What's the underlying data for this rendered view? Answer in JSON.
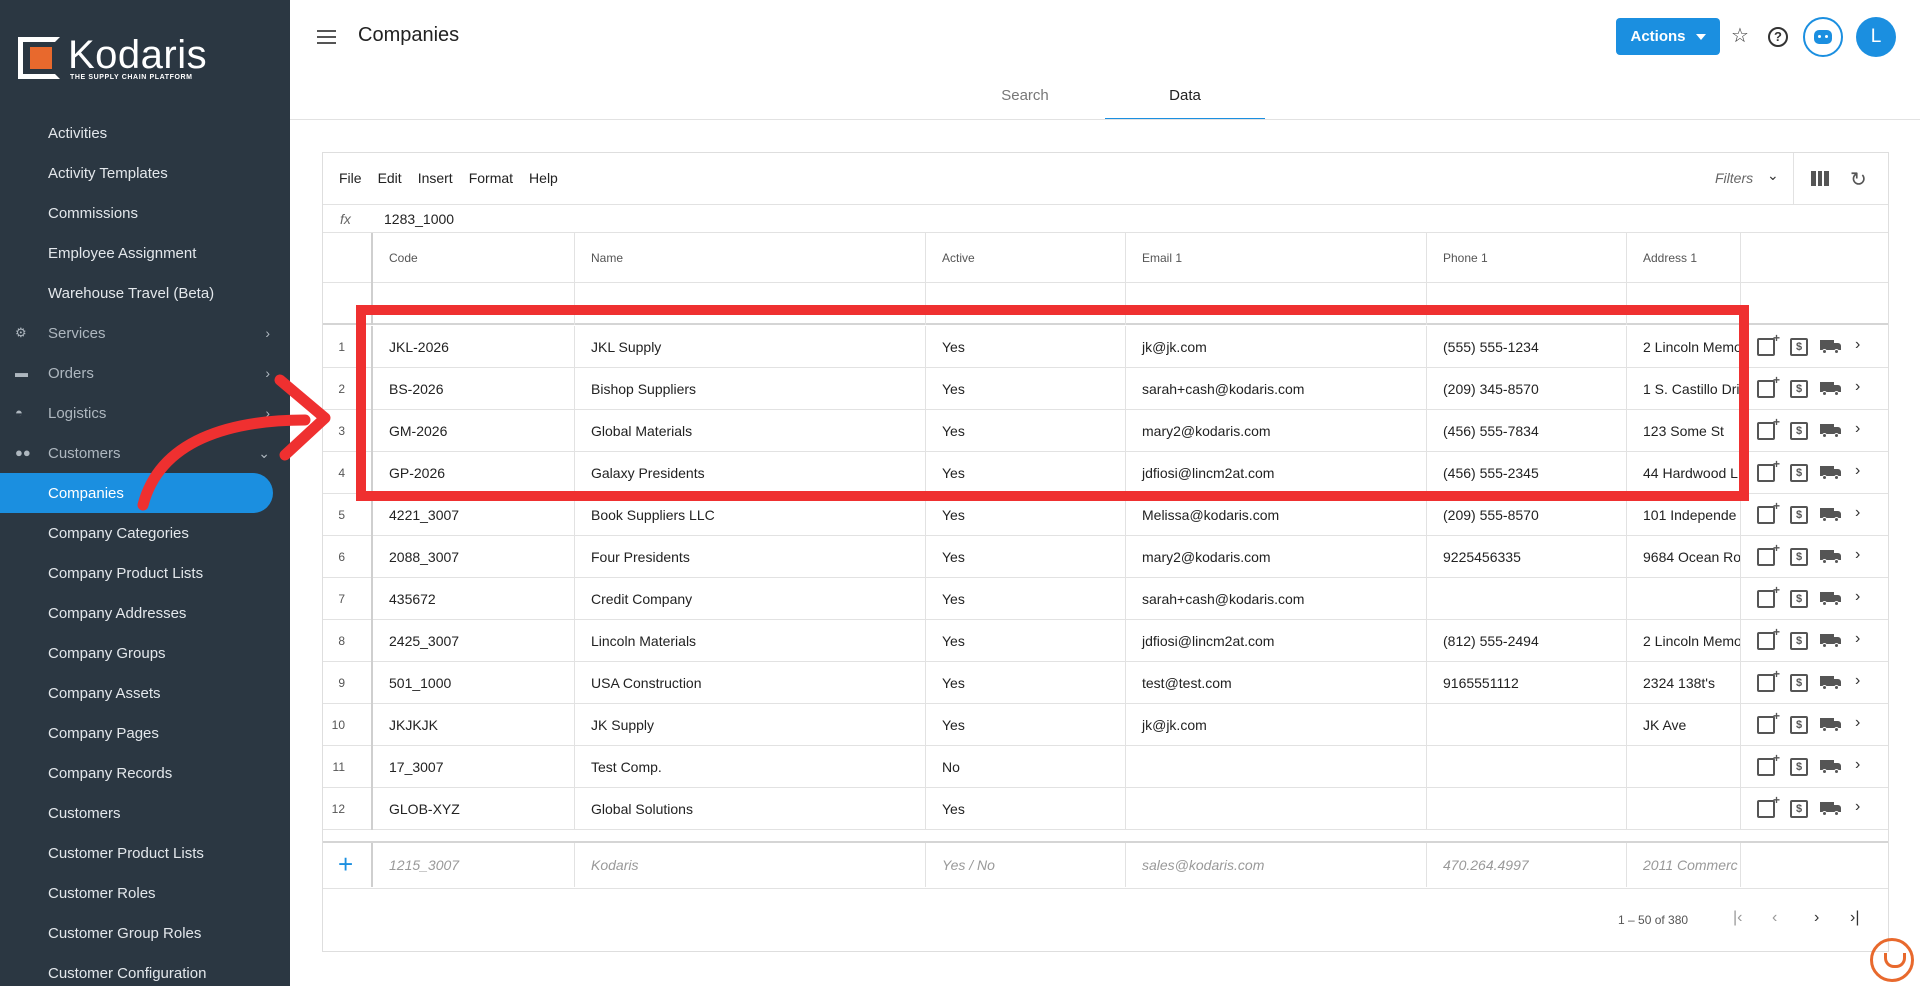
{
  "brand": {
    "name": "Kodaris",
    "tagline": "THE SUPPLY CHAIN PLATFORM"
  },
  "sidebar": {
    "items": [
      {
        "label": "Activities",
        "type": "sub"
      },
      {
        "label": "Activity Templates",
        "type": "sub"
      },
      {
        "label": "Commissions",
        "type": "sub"
      },
      {
        "label": "Employee Assignment",
        "type": "sub"
      },
      {
        "label": "Warehouse Travel (Beta)",
        "type": "sub"
      },
      {
        "label": "Services",
        "type": "group",
        "icon": "services-icon"
      },
      {
        "label": "Orders",
        "type": "group",
        "icon": "truck-icon"
      },
      {
        "label": "Logistics",
        "type": "group",
        "icon": "car-icon"
      },
      {
        "label": "Customers",
        "type": "group",
        "icon": "people-icon"
      },
      {
        "label": "Companies",
        "type": "active"
      },
      {
        "label": "Company Categories",
        "type": "sub"
      },
      {
        "label": "Company Product Lists",
        "type": "sub"
      },
      {
        "label": "Company Addresses",
        "type": "sub"
      },
      {
        "label": "Company Groups",
        "type": "sub"
      },
      {
        "label": "Company Assets",
        "type": "sub"
      },
      {
        "label": "Company Pages",
        "type": "sub"
      },
      {
        "label": "Company Records",
        "type": "sub"
      },
      {
        "label": "Customers",
        "type": "sub"
      },
      {
        "label": "Customer Product Lists",
        "type": "sub"
      },
      {
        "label": "Customer Roles",
        "type": "sub"
      },
      {
        "label": "Customer Group Roles",
        "type": "sub"
      },
      {
        "label": "Customer Configuration",
        "type": "sub"
      }
    ]
  },
  "header": {
    "title": "Companies",
    "actions_label": "Actions",
    "avatar_initial": "L"
  },
  "tabs": [
    {
      "label": "Search"
    },
    {
      "label": "Data"
    }
  ],
  "toolbar": {
    "menu": [
      "File",
      "Edit",
      "Insert",
      "Format",
      "Help"
    ],
    "filters_label": "Filters"
  },
  "formula": {
    "label": "fx",
    "value": "1283_1000"
  },
  "grid": {
    "columns": [
      "Code",
      "Name",
      "Active",
      "Email 1",
      "Phone 1",
      "Address 1"
    ],
    "rows": [
      [
        "1",
        "JKL-2026",
        "JKL Supply",
        "Yes",
        "jk@jk.com",
        "(555) 555-1234",
        "2 Lincoln Memo"
      ],
      [
        "2",
        "BS-2026",
        "Bishop Suppliers",
        "Yes",
        "sarah+cash@kodaris.com",
        "(209) 345-8570",
        "1 S. Castillo Dri"
      ],
      [
        "3",
        "GM-2026",
        "Global Materials",
        "Yes",
        "mary2@kodaris.com",
        "(456) 555-7834",
        "123 Some St"
      ],
      [
        "4",
        "GP-2026",
        "Galaxy Presidents",
        "Yes",
        "jdfiosi@lincm2at.com",
        "(456) 555-2345",
        "44 Hardwood L"
      ],
      [
        "5",
        "4221_3007",
        "Book Suppliers LLC",
        "Yes",
        "Melissa@kodaris.com",
        "(209) 555-8570",
        "101 Independe"
      ],
      [
        "6",
        "2088_3007",
        "Four Presidents",
        "Yes",
        "mary2@kodaris.com",
        "9225456335",
        "9684 Ocean Ro"
      ],
      [
        "7",
        "435672",
        "Credit Company",
        "Yes",
        "sarah+cash@kodaris.com",
        "",
        ""
      ],
      [
        "8",
        "2425_3007",
        "Lincoln Materials",
        "Yes",
        "jdfiosi@lincm2at.com",
        "(812) 555-2494",
        "2 Lincoln Memo"
      ],
      [
        "9",
        "501_1000",
        "USA Construction",
        "Yes",
        "test@test.com",
        "9165551112",
        "2324 138t's"
      ],
      [
        "10",
        "JKJKJK",
        "JK Supply",
        "Yes",
        "jk@jk.com",
        "",
        "JK Ave"
      ],
      [
        "11",
        "17_3007",
        "Test Comp.",
        "No",
        "",
        "",
        ""
      ],
      [
        "12",
        "GLOB-XYZ",
        "Global Solutions",
        "Yes",
        "",
        "",
        ""
      ]
    ],
    "new_row": [
      "1215_3007",
      "Kodaris",
      "Yes / No",
      "sales@kodaris.com",
      "470.264.4997",
      "2011 Commerc"
    ]
  },
  "pager": {
    "range": "1 – 50 of 380"
  },
  "colors": {
    "accent": "#1b8fe0",
    "sidebar_bg": "#2b3742",
    "highlight": "#ef3030",
    "brand_orange": "#e8692d"
  }
}
